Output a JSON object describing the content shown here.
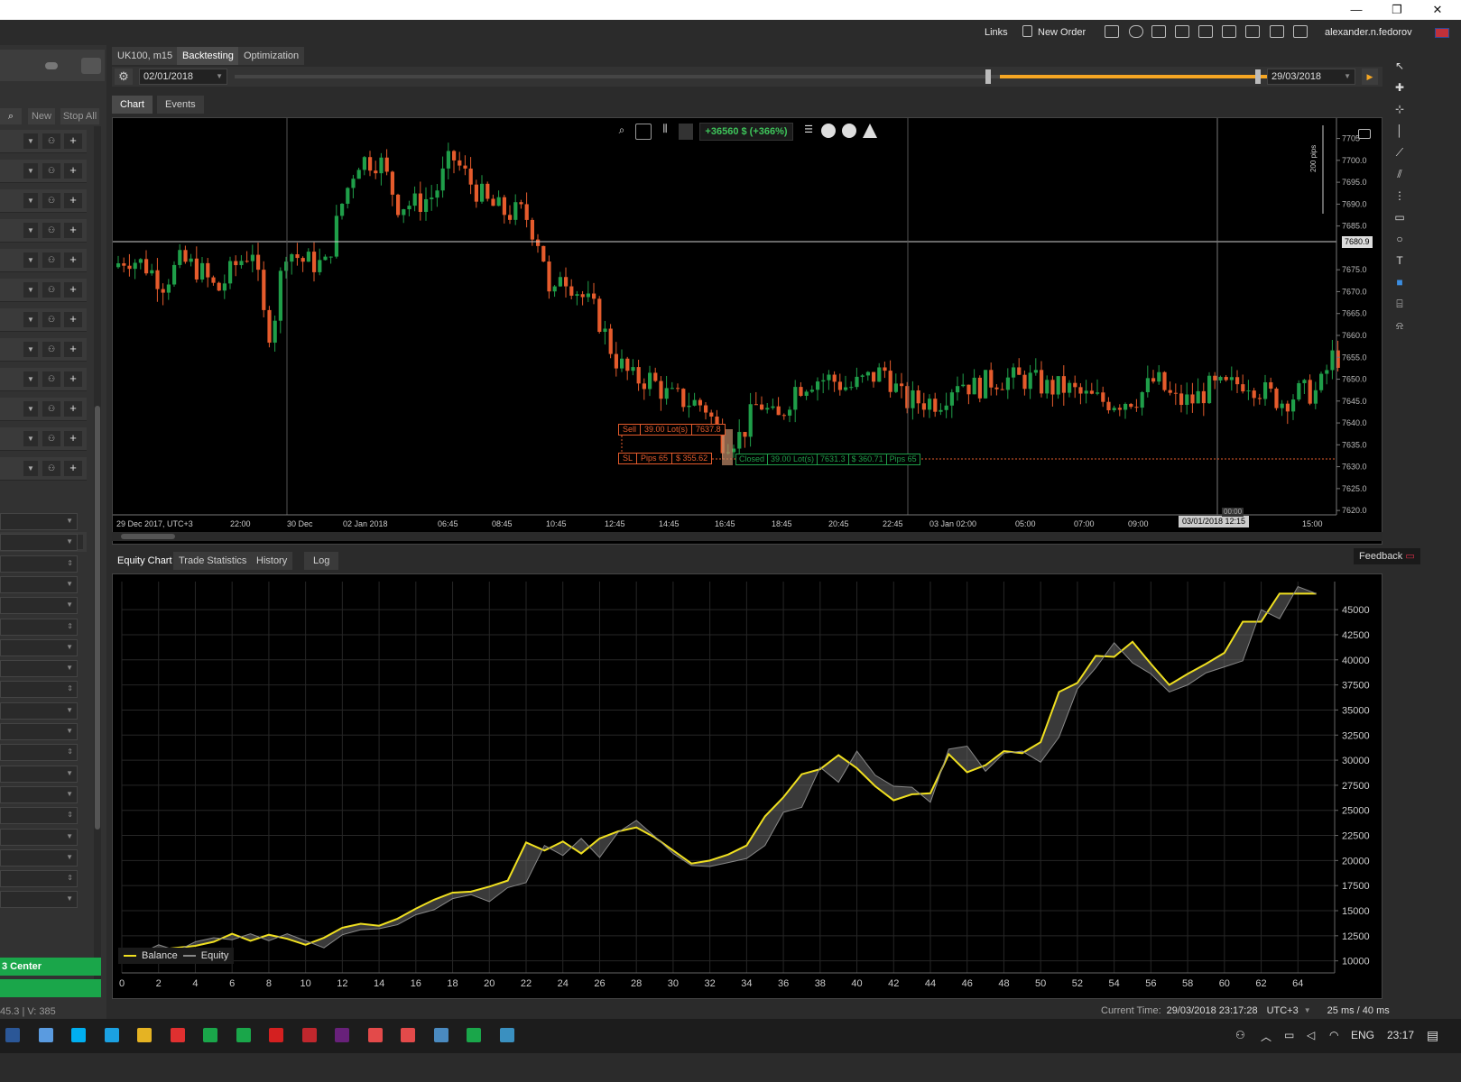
{
  "window": {
    "title": "",
    "min": "—",
    "restore": "❐",
    "close": "✕"
  },
  "toolbar": {
    "links": "Links",
    "new_order": "New Order",
    "user": "alexander.n.fedorov"
  },
  "left": {
    "search_icon": "search-icon",
    "new_label": "New",
    "stop_all_label": "Stop All",
    "center_label": "3 Center",
    "status": "45.3 | V: 385"
  },
  "tabs": {
    "symbol": "UK100, m15",
    "backtesting": "Backtesting",
    "optimization": "Optimization"
  },
  "range": {
    "start": "02/01/2018",
    "end": "29/03/2018",
    "position": 1.0
  },
  "chart_tabs": {
    "chart": "Chart",
    "events": "Events"
  },
  "chart_toolbar": {
    "pnl": "+36560 $ (+366%)"
  },
  "price_chart": {
    "y_ticks": [
      "7705",
      "7700.0",
      "7695.0",
      "7690.0",
      "7685.0",
      "7675.0",
      "7670.0",
      "7665.0",
      "7660.0",
      "7655.0",
      "7650.0",
      "7645.0",
      "7640.0",
      "7635.0",
      "7630.0",
      "7625.0",
      "7620.0"
    ],
    "crosshair_price": "7680.9",
    "pips_label": "200 pips",
    "x_ticks": [
      "29 Dec 2017, UTC+3",
      "22:00",
      "30 Dec",
      "02 Jan 2018",
      "06:45",
      "08:45",
      "10:45",
      "12:45",
      "14:45",
      "16:45",
      "18:45",
      "20:45",
      "22:45",
      "03 Jan 02:00",
      "05:00",
      "07:00",
      "09:00",
      "11:00",
      "15:00"
    ],
    "crosshair_time": "03/01/2018 12:15",
    "crosshair_small": "00:00",
    "sell_label": "Sell",
    "sell_lots": "39.00 Lot(s)",
    "sell_price": "7637.8",
    "sl_label": "SL",
    "sl_pips": "Pips 65",
    "sl_amount": "$ 355.62",
    "closed_label": "Closed",
    "closed_lots": "39.00 Lot(s)",
    "closed_price": "7631.3",
    "closed_amount": "$ 360.71",
    "closed_pips": "Pips 65"
  },
  "bottom_tabs": {
    "equity": "Equity Chart",
    "stats": "Trade Statistics",
    "history": "History",
    "log": "Log",
    "feedback": "Feedback"
  },
  "chart_data": {
    "type": "line",
    "x": [
      0,
      1,
      2,
      3,
      4,
      5,
      6,
      7,
      8,
      9,
      10,
      11,
      12,
      13,
      14,
      15,
      16,
      17,
      18,
      19,
      20,
      21,
      22,
      23,
      24,
      25,
      26,
      27,
      28,
      29,
      30,
      31,
      32,
      33,
      34,
      35,
      36,
      37,
      38,
      39,
      40,
      41,
      42,
      43,
      44,
      45,
      46,
      47,
      48,
      49,
      50,
      51,
      52,
      53,
      54,
      55,
      56,
      57,
      58,
      59,
      60,
      61,
      62,
      63,
      64,
      65
    ],
    "series": [
      {
        "name": "Balance",
        "color": "#f0e020",
        "values": [
          10000,
          10400,
          11100,
          11300,
          11500,
          11900,
          12700,
          12000,
          12600,
          12200,
          11600,
          12300,
          13300,
          13700,
          13500,
          14200,
          15200,
          16100,
          16800,
          16900,
          17400,
          18000,
          21800,
          21000,
          21900,
          20700,
          22200,
          22900,
          23300,
          22300,
          21000,
          19700,
          20000,
          20600,
          21500,
          24400,
          26300,
          28600,
          29100,
          30500,
          29200,
          27400,
          26000,
          26600,
          26700,
          30600,
          28800,
          29500,
          30900,
          30700,
          31800,
          36800,
          37700,
          40400,
          40300,
          41800,
          39600,
          37500,
          38600,
          39600,
          40700,
          43800,
          43800,
          46600,
          46600,
          46600
        ]
      },
      {
        "name": "Equity",
        "color": "#888888",
        "values": [
          10000,
          10700,
          11600,
          11000,
          11900,
          12300,
          12100,
          12700,
          12000,
          12700,
          12000,
          11300,
          12600,
          13100,
          13200,
          13600,
          14600,
          15100,
          16200,
          16600,
          15900,
          17300,
          17800,
          21500,
          20500,
          22200,
          20300,
          22800,
          24000,
          22400,
          20700,
          19500,
          19400,
          19800,
          20200,
          21500,
          24800,
          25300,
          29300,
          27800,
          30900,
          28500,
          27400,
          27300,
          25800,
          31100,
          31400,
          28900,
          30700,
          30900,
          29800,
          32300,
          37100,
          39200,
          41700,
          39700,
          38600,
          36800,
          37500,
          38700,
          39300,
          39900,
          45000,
          44100,
          47300,
          46600
        ]
      }
    ],
    "x_ticks": [
      "0",
      "2",
      "4",
      "6",
      "8",
      "10",
      "12",
      "14",
      "16",
      "18",
      "20",
      "22",
      "24",
      "26",
      "28",
      "30",
      "32",
      "34",
      "36",
      "38",
      "40",
      "42",
      "44",
      "46",
      "48",
      "50",
      "52",
      "54",
      "56",
      "58",
      "60",
      "62",
      "64"
    ],
    "y_ticks": [
      "10000",
      "12500",
      "15000",
      "17500",
      "20000",
      "22500",
      "25000",
      "27500",
      "30000",
      "32500",
      "35000",
      "37500",
      "40000",
      "42500",
      "45000"
    ],
    "xlim": [
      0,
      66
    ],
    "ylim": [
      8800,
      47800
    ],
    "grid": true,
    "legend": "bottom-left"
  },
  "status_bar": {
    "current_time_label": "Current Time:",
    "current_time": "29/03/2018 23:17:28",
    "timezone": "UTC+3",
    "latency": "25 ms / 40 ms"
  },
  "taskbar": {
    "lang": "ENG",
    "clock": "23:17"
  }
}
